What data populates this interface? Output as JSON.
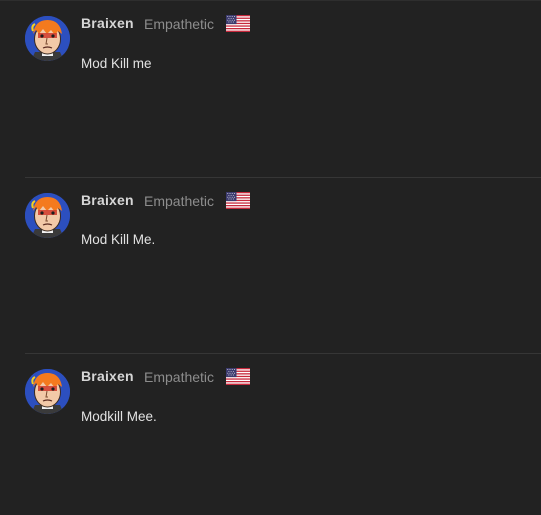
{
  "posts": [
    {
      "username": "Braixen",
      "rank": "Empathetic",
      "flag_icon": "us-flag-icon",
      "avatar_icon": "cartoon-face-avatar",
      "message": "Mod Kill me"
    },
    {
      "username": "Braixen",
      "rank": "Empathetic",
      "flag_icon": "us-flag-icon",
      "avatar_icon": "cartoon-face-avatar",
      "message": "Mod Kill Me."
    },
    {
      "username": "Braixen",
      "rank": "Empathetic",
      "flag_icon": "us-flag-icon",
      "avatar_icon": "cartoon-face-avatar",
      "message": "Modkill Mee."
    }
  ],
  "colors": {
    "background": "#222222",
    "divider": "#363636",
    "username": "#d6d6d6",
    "rank": "#8d8d8d",
    "message": "#e2e2e2"
  }
}
